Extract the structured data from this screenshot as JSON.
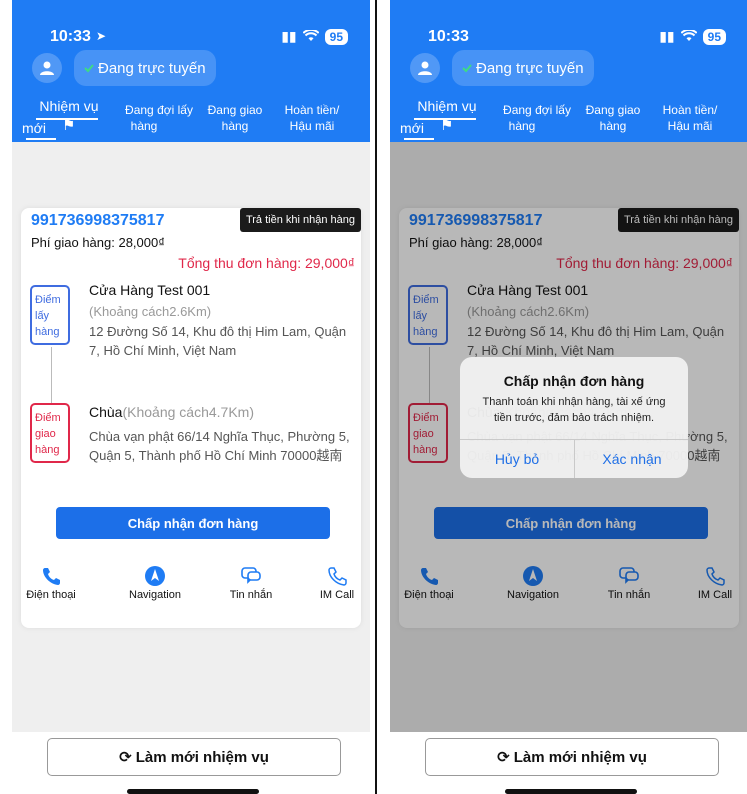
{
  "status_bar": {
    "time": "10:33",
    "battery": "95"
  },
  "header": {
    "online_status": "Đang trực tuyến"
  },
  "tabs": [
    {
      "line1": "Nhiệm vụ",
      "line2": "mới"
    },
    {
      "line1": "Đang đợi lấy",
      "line2": "hàng"
    },
    {
      "line1": "Đang giao",
      "line2": "hàng"
    },
    {
      "line1": "Hoàn tiền/",
      "line2": "Hậu mãi"
    }
  ],
  "order": {
    "id": "991736998375817",
    "payment_badge": "Trả tiền khi nhận hàng",
    "shipping_fee": "Phí giao hàng: 28,000₫",
    "total": "Tổng thu đơn hàng: 29,000₫",
    "pickup": {
      "label_lines": [
        "Điểm",
        "lấy",
        "hàng"
      ],
      "name": "Cửa Hàng Test 001",
      "distance": "(Khoảng cách2.6Km)",
      "address": "12 Đường Số 14, Khu đô thị Him Lam, Quận 7, Hồ Chí Minh, Việt Nam"
    },
    "dropoff": {
      "label_lines": [
        "Điểm",
        "giao",
        "hàng"
      ],
      "name": "Chùa",
      "distance": "(Khoảng cách4.7Km)",
      "address": "Chùa vạn phật 66/14 Nghĩa Thục, Phường 5, Quận 5, Thành phố Hồ Chí Minh 70000越南"
    },
    "accept_button": "Chấp nhận đơn hàng"
  },
  "actions": [
    {
      "label": "Điện thoại",
      "icon": "phone-icon"
    },
    {
      "label": "Navigation",
      "icon": "compass-icon"
    },
    {
      "label": "Tin nhắn",
      "icon": "chat-icon"
    },
    {
      "label": "IM Call",
      "icon": "call-outline-icon"
    }
  ],
  "refresh_button": "Làm mới nhiệm vụ",
  "dialog": {
    "title": "Chấp nhận đơn hàng",
    "message": "Thanh toán khi nhận hàng, tài xế ứng tiền trước, đảm bảo trách nhiệm.",
    "cancel": "Hủy bỏ",
    "confirm": "Xác nhận"
  },
  "colors": {
    "primary": "#1f7cf4",
    "danger": "#e0284a",
    "pickup": "#3f6ce0"
  }
}
